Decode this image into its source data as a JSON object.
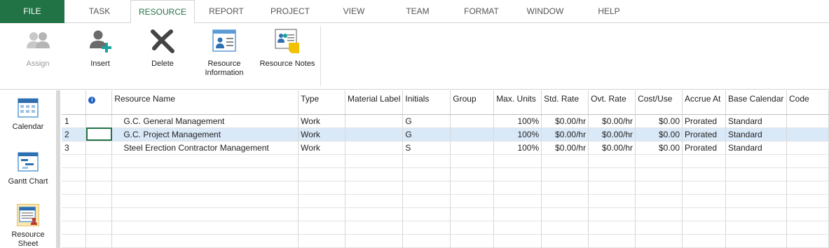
{
  "tabs": [
    "FILE",
    "TASK",
    "RESOURCE",
    "REPORT",
    "PROJECT",
    "VIEW",
    "TEAM",
    "FORMAT",
    "WINDOW",
    "HELP"
  ],
  "active_tab": "RESOURCE",
  "ribbon": {
    "assign_label": "Assign",
    "insert_label": "Insert",
    "delete_label": "Delete",
    "resource_information_line1": "Resource",
    "resource_information_line2": "Information",
    "resource_notes_label": "Resource Notes"
  },
  "views": {
    "calendar_label": "Calendar",
    "gantt_label": "Gantt Chart",
    "resource_sheet_line1": "Resource",
    "resource_sheet_line2": "Sheet"
  },
  "grid": {
    "columns": [
      "",
      "Resource Name",
      "Type",
      "Material Label",
      "Initials",
      "Group",
      "Max. Units",
      "Std. Rate",
      "Ovt. Rate",
      "Cost/Use",
      "Accrue At",
      "Base Calendar",
      "Code"
    ],
    "rows": [
      {
        "id": "1",
        "name": "G.C. General Management",
        "type": "Work",
        "material": "",
        "initials": "G",
        "group": "",
        "max_units": "100%",
        "std_rate": "$0.00/hr",
        "ovt_rate": "$0.00/hr",
        "cost_use": "$0.00",
        "accrue": "Prorated",
        "calendar": "Standard",
        "code": ""
      },
      {
        "id": "2",
        "name": "G.C. Project Management",
        "type": "Work",
        "material": "",
        "initials": "G",
        "group": "",
        "max_units": "100%",
        "std_rate": "$0.00/hr",
        "ovt_rate": "$0.00/hr",
        "cost_use": "$0.00",
        "accrue": "Prorated",
        "calendar": "Standard",
        "code": ""
      },
      {
        "id": "3",
        "name": "Steel Erection Contractor Management",
        "type": "Work",
        "material": "",
        "initials": "S",
        "group": "",
        "max_units": "100%",
        "std_rate": "$0.00/hr",
        "ovt_rate": "$0.00/hr",
        "cost_use": "$0.00",
        "accrue": "Prorated",
        "calendar": "Standard",
        "code": ""
      }
    ],
    "selected_row": "2"
  },
  "colors": {
    "file_tab": "#217346",
    "selection": "#dae9f8",
    "info_icon": "#1f5fbf"
  }
}
